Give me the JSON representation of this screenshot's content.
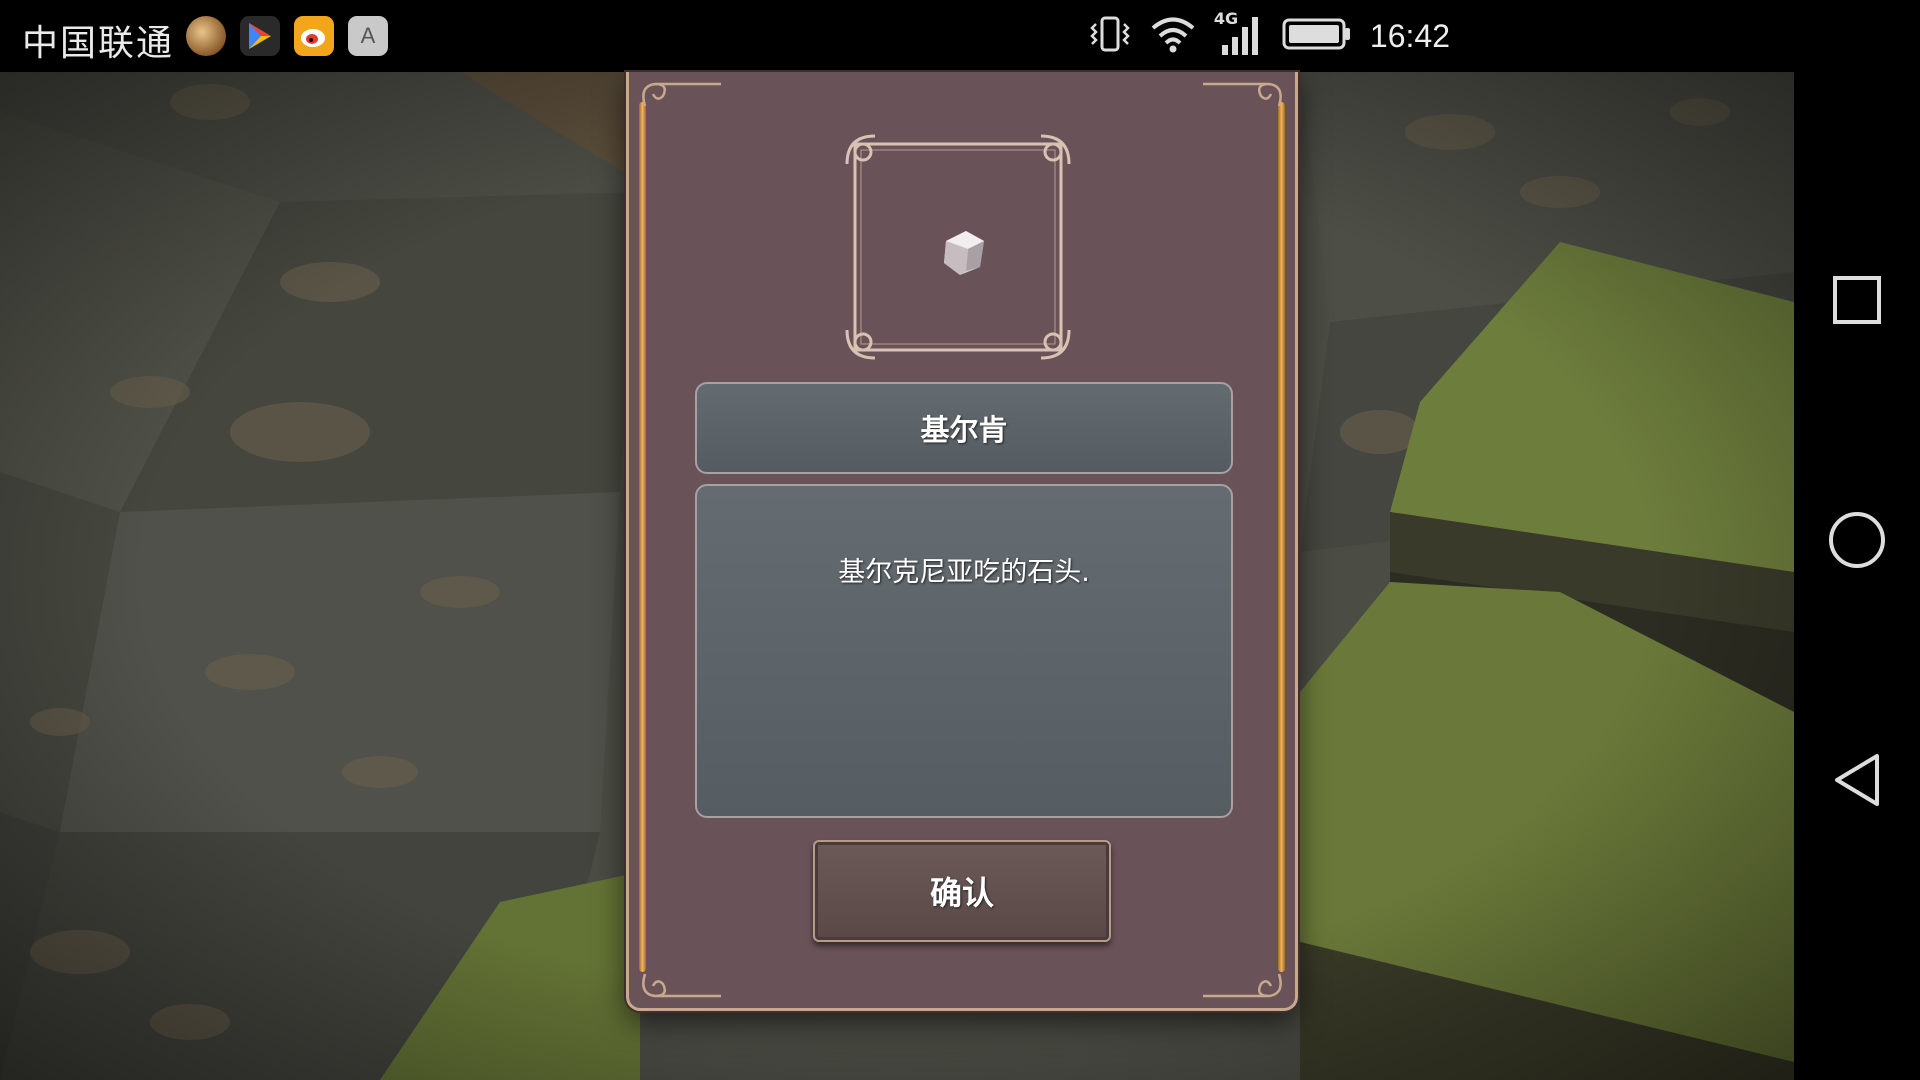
{
  "status_bar": {
    "carrier": "中国联通",
    "app_icons": [
      "game-app-icon",
      "play-store-icon",
      "weibo-icon",
      "font-app-icon"
    ],
    "app4_letter": "A",
    "network_label": "4G",
    "time": "16:42"
  },
  "dialog": {
    "item_icon": "stone-icon",
    "item_name": "基尔肯",
    "item_description": "基尔克尼亚吃的石头.",
    "confirm_label": "确认"
  },
  "nav_bar": {
    "icons": [
      "recent-apps-icon",
      "home-icon",
      "back-icon"
    ]
  },
  "colors": {
    "dialog_bg": "#6a5358",
    "gold_accent": "#f1b65e",
    "panel_bg": "#5e666b",
    "grass": "#6b7a3a",
    "floor": "#4c4c44"
  }
}
